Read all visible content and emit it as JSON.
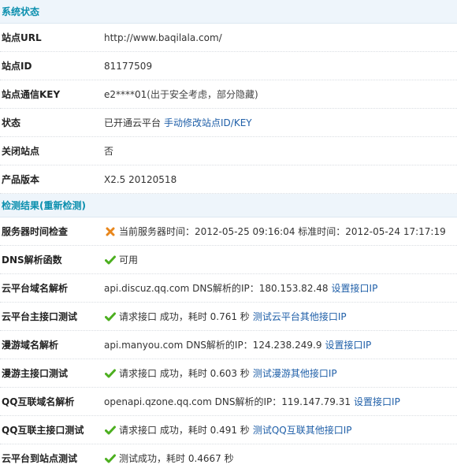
{
  "system_section": {
    "title": "系统状态",
    "rows": {
      "site_url": {
        "label": "站点URL",
        "value": "http://www.baqilala.com/"
      },
      "site_id": {
        "label": "站点ID",
        "value": "81177509"
      },
      "site_key": {
        "label": "站点通信KEY",
        "value": "e2****01",
        "note": "(出于安全考虑，部分隐藏)"
      },
      "status": {
        "label": "状态",
        "value": "已开通云平台",
        "link": "手动修改站点ID/KEY"
      },
      "close_site": {
        "label": "关闭站点",
        "value": "否"
      },
      "product_version": {
        "label": "产品版本",
        "value": "X2.5 20120518"
      }
    }
  },
  "check_section": {
    "title": "检测结果(重新检测)",
    "rows": {
      "server_time": {
        "label": "服务器时间检查",
        "status_icon": "cross-icon",
        "value": "当前服务器时间：2012-05-25 09:16:04 标准时间：2012-05-24 17:17:19"
      },
      "dns_func": {
        "label": "DNS解析函数",
        "status_icon": "check-icon",
        "value": "可用"
      },
      "cloud_dns": {
        "label": "云平台域名解析",
        "value": "api.discuz.qq.com DNS解析的IP：180.153.82.48",
        "link": "设置接口IP"
      },
      "cloud_api": {
        "label": "云平台主接口测试",
        "status_icon": "check-icon",
        "value": "请求接口 成功，耗时 0.761 秒",
        "link": "测试云平台其他接口IP"
      },
      "manyou_dns": {
        "label": "漫游域名解析",
        "value": "api.manyou.com DNS解析的IP：124.238.249.9",
        "link": "设置接口IP"
      },
      "manyou_api": {
        "label": "漫游主接口测试",
        "status_icon": "check-icon",
        "value": "请求接口 成功，耗时 0.603 秒",
        "link": "测试漫游其他接口IP"
      },
      "qq_dns": {
        "label": "QQ互联域名解析",
        "value": "openapi.qzone.qq.com DNS解析的IP：119.147.79.31",
        "link": "设置接口IP"
      },
      "qq_api": {
        "label": "QQ互联主接口测试",
        "status_icon": "check-icon",
        "value": "请求接口 成功，耗时 0.491 秒",
        "link": "测试QQ互联其他接口IP"
      },
      "cloud_to_site": {
        "label": "云平台到站点测试",
        "status_icon": "check-icon",
        "value": "测试成功，耗时 0.4667 秒"
      }
    }
  },
  "colors": {
    "header_text": "#0b8fae",
    "header_bg": "#eef5fb",
    "link": "#1f5fa8",
    "check": "#4caf1f",
    "cross": "#e8861b"
  }
}
